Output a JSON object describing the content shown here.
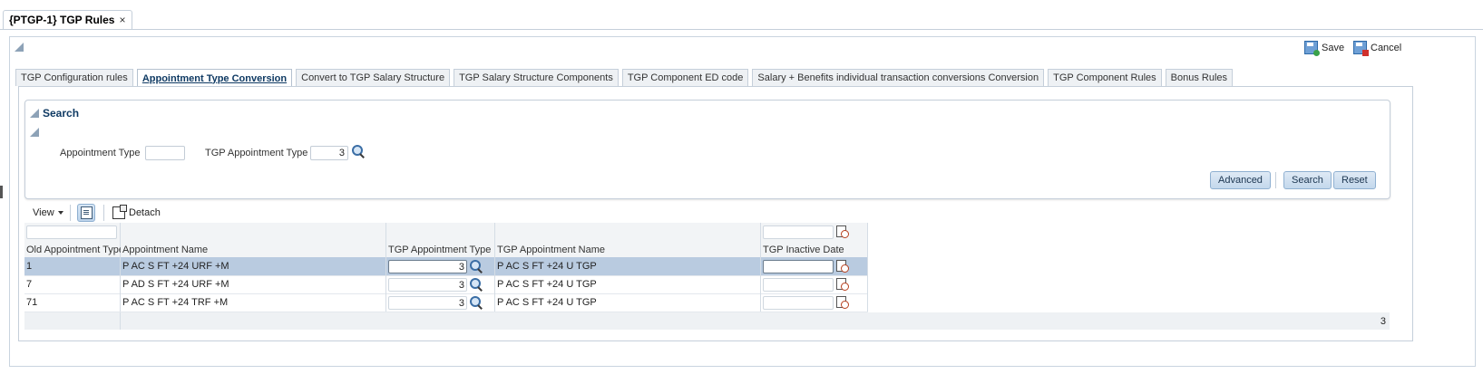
{
  "doc_tab": {
    "title": "{PTGP-1} TGP Rules",
    "close": "×"
  },
  "toolbar": {
    "save": "Save",
    "cancel": "Cancel"
  },
  "tabs": [
    {
      "label": "TGP Configuration rules"
    },
    {
      "label": "Appointment Type Conversion",
      "active": true
    },
    {
      "label": "Convert to TGP Salary Structure"
    },
    {
      "label": "TGP Salary Structure Components"
    },
    {
      "label": "TGP Component ED code"
    },
    {
      "label": "Salary + Benefits individual transaction conversions Conversion"
    },
    {
      "label": "TGP Component Rules"
    },
    {
      "label": "Bonus Rules"
    }
  ],
  "search": {
    "title": "Search",
    "fields": {
      "appointment_type": {
        "label": "Appointment Type",
        "value": ""
      },
      "tgp_appointment_type": {
        "label": "TGP Appointment Type",
        "value": "3"
      }
    },
    "buttons": {
      "advanced": "Advanced",
      "search": "Search",
      "reset": "Reset"
    }
  },
  "table_toolbar": {
    "view": "View",
    "detach": "Detach"
  },
  "table": {
    "columns": [
      "Old Appointment Type",
      "Appointment Name",
      "TGP Appointment Type",
      "TGP Appointment Name",
      "TGP Inactive Date"
    ],
    "rows": [
      {
        "old": "1",
        "name": "P AC S FT +24 URF +M",
        "tgp_type": "3",
        "tgp_name": "P AC S FT +24 U TGP",
        "inactive": "",
        "selected": true
      },
      {
        "old": "7",
        "name": "P AD S FT +24 URF +M",
        "tgp_type": "3",
        "tgp_name": "P AC S FT +24 U TGP",
        "inactive": ""
      },
      {
        "old": "71",
        "name": "P AC S FT +24 TRF +M",
        "tgp_type": "3",
        "tgp_name": "P AC S FT +24 U TGP",
        "inactive": ""
      }
    ],
    "row_count": "3"
  },
  "colors": {
    "selected_row": "#b9cbe0",
    "tab_active_text": "#0f3a63",
    "button_bg": "#c3d8ec"
  }
}
